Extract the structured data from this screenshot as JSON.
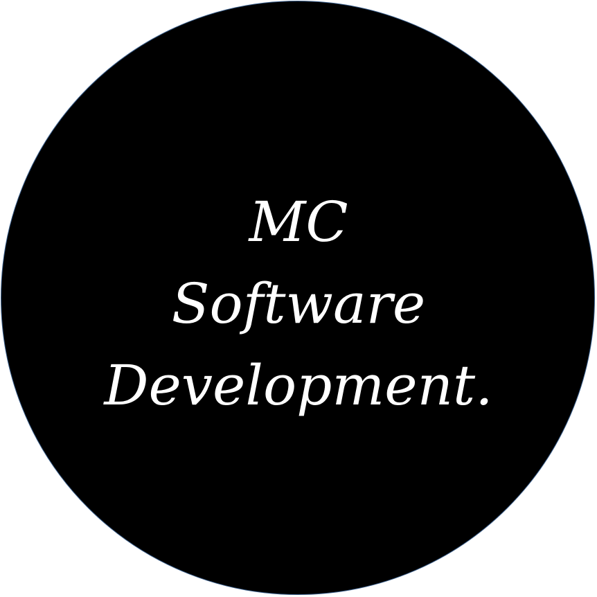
{
  "logo": {
    "lines": [
      "MC",
      "Software",
      "Development."
    ],
    "colors": {
      "background": "#000000",
      "text": "#ffffff",
      "border": "#3a5f8c",
      "page": "#ffffff"
    }
  }
}
